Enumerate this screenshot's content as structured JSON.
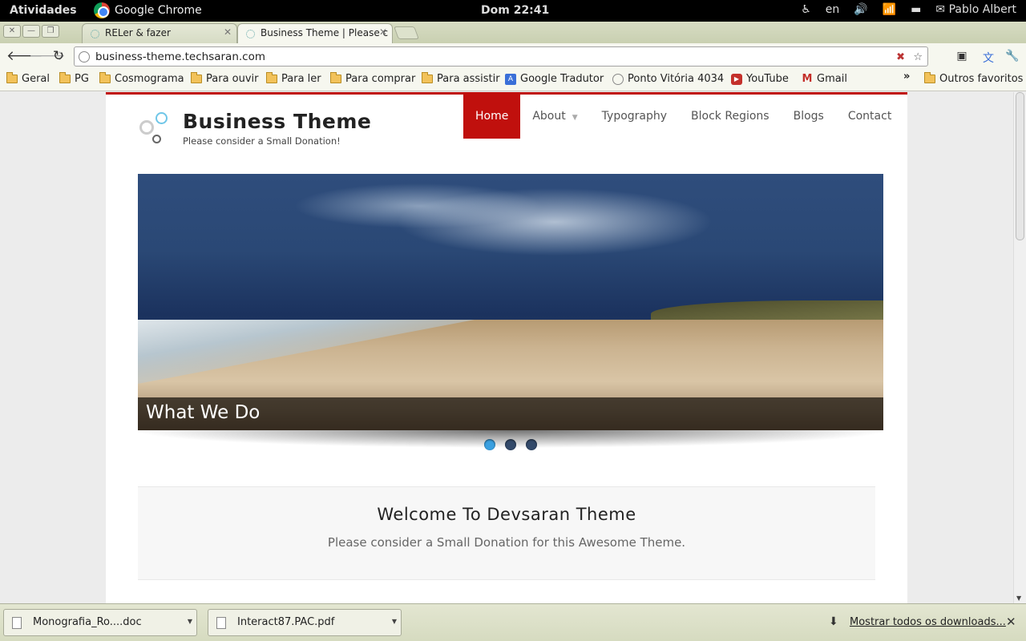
{
  "system_bar": {
    "activities": "Atividades",
    "app_name": "Google Chrome",
    "clock": "Dom 22:41",
    "keyboard_layout": "en",
    "user": "Pablo Albert"
  },
  "tabs": [
    {
      "title": "RELer & fazer",
      "active": false
    },
    {
      "title": "Business Theme | Please c",
      "active": true
    }
  ],
  "omnibox": {
    "url": "business-theme.techsaran.com"
  },
  "bookmarks": [
    {
      "label": "Geral",
      "icon": "folder-icon"
    },
    {
      "label": "PG",
      "icon": "folder-icon"
    },
    {
      "label": "Cosmograma",
      "icon": "folder-icon"
    },
    {
      "label": "Para ouvir",
      "icon": "folder-icon"
    },
    {
      "label": "Para ler",
      "icon": "folder-icon"
    },
    {
      "label": "Para comprar",
      "icon": "folder-icon"
    },
    {
      "label": "Para assistir",
      "icon": "folder-icon"
    },
    {
      "label": "Google Tradutor",
      "icon": "translate-icon"
    },
    {
      "label": "Ponto Vitória 4034",
      "icon": "globe-icon"
    },
    {
      "label": "YouTube",
      "icon": "youtube-icon"
    },
    {
      "label": "Gmail",
      "icon": "gmail-icon"
    }
  ],
  "bookmarks_more": "»",
  "other_bookmarks": "Outros favoritos",
  "site": {
    "title": "Business Theme",
    "slogan": "Please consider a Small Donation!",
    "menu": [
      {
        "label": "Home",
        "active": true
      },
      {
        "label": "About",
        "has_submenu": true
      },
      {
        "label": "Typography"
      },
      {
        "label": "Block Regions"
      },
      {
        "label": "Blogs"
      },
      {
        "label": "Contact"
      }
    ],
    "slider": {
      "caption": "What We Do",
      "slides": 3,
      "current": 1
    },
    "welcome": {
      "heading": "Welcome To Devsaran Theme",
      "text": "Please consider a Small Donation for this Awesome Theme."
    },
    "accent_color": "#c0100d"
  },
  "downloads": {
    "items": [
      {
        "name": "Monografia_Ro....doc"
      },
      {
        "name": "Interact87.PAC.pdf"
      }
    ],
    "show_all": "Mostrar todos os downloads..."
  }
}
